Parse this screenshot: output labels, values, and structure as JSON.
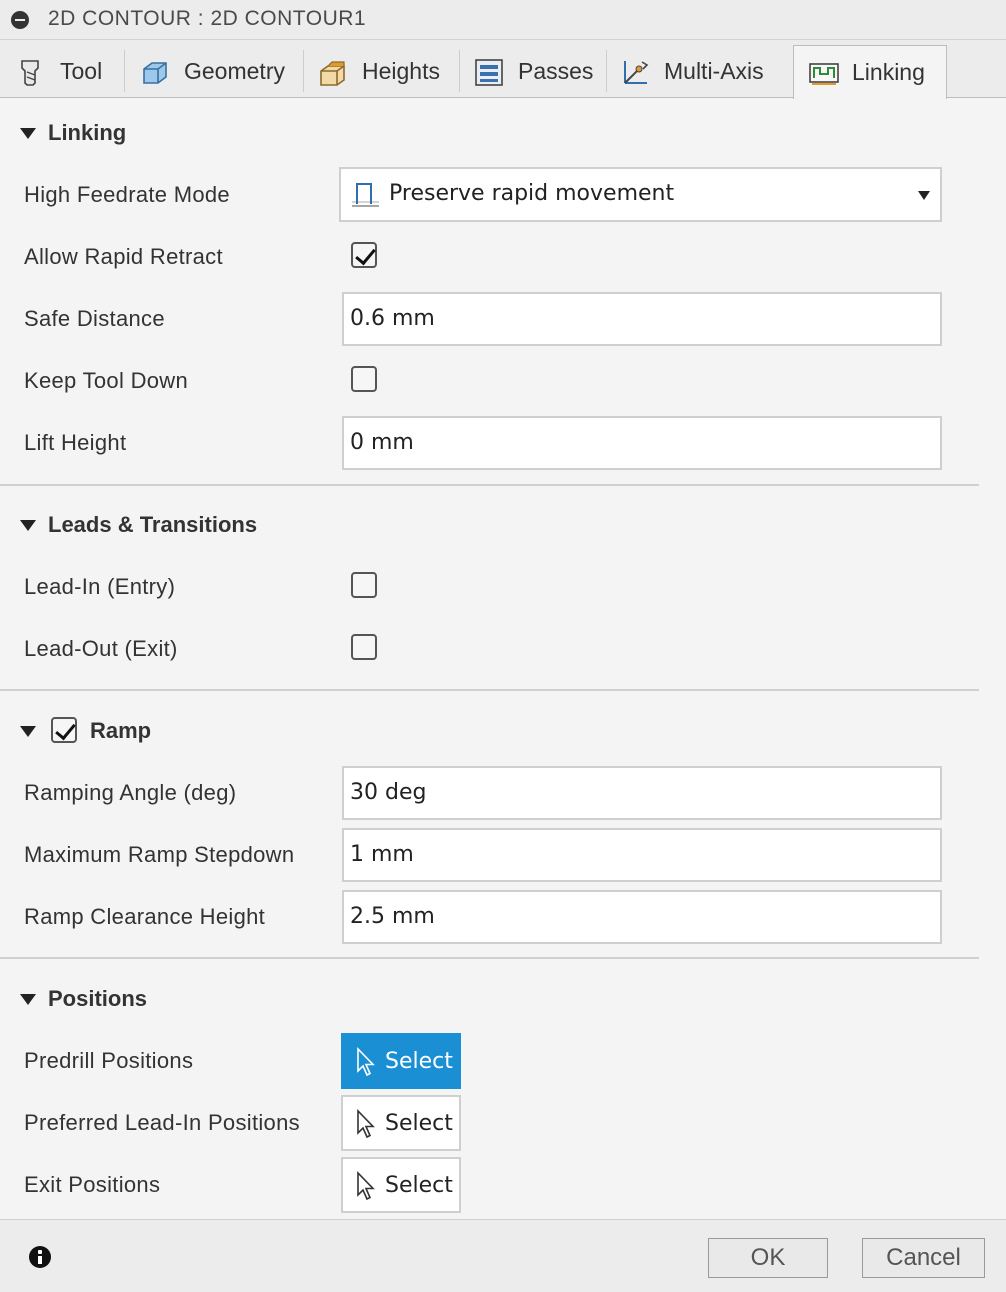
{
  "window": {
    "title": "2D CONTOUR : 2D CONTOUR1"
  },
  "tabs": [
    {
      "label": "Tool",
      "icon": "tool-icon"
    },
    {
      "label": "Geometry",
      "icon": "geometry-icon"
    },
    {
      "label": "Heights",
      "icon": "heights-icon"
    },
    {
      "label": "Passes",
      "icon": "passes-icon"
    },
    {
      "label": "Multi-Axis",
      "icon": "multi-axis-icon"
    },
    {
      "label": "Linking",
      "icon": "linking-icon",
      "active": true
    }
  ],
  "linking": {
    "title": "Linking",
    "high_feedrate_mode": {
      "label": "High Feedrate Mode",
      "value": "Preserve rapid movement"
    },
    "allow_rapid_retract": {
      "label": "Allow Rapid Retract",
      "checked": true
    },
    "safe_distance": {
      "label": "Safe Distance",
      "value": "0.6 mm"
    },
    "keep_tool_down": {
      "label": "Keep Tool Down",
      "checked": false
    },
    "lift_height": {
      "label": "Lift Height",
      "value": "0 mm"
    }
  },
  "leads": {
    "title": "Leads & Transitions",
    "lead_in": {
      "label": "Lead-In (Entry)",
      "checked": false
    },
    "lead_out": {
      "label": "Lead-Out (Exit)",
      "checked": false
    }
  },
  "ramp": {
    "title": "Ramp",
    "enabled": true,
    "ramping_angle": {
      "label": "Ramping Angle (deg)",
      "value": "30 deg"
    },
    "max_ramp_stepdown": {
      "label": "Maximum Ramp Stepdown",
      "value": "1 mm"
    },
    "ramp_clearance_height": {
      "label": "Ramp Clearance Height",
      "value": "2.5 mm"
    }
  },
  "positions": {
    "title": "Positions",
    "predrill": {
      "label": "Predrill Positions",
      "button": "Select"
    },
    "preferred_lead_in": {
      "label": "Preferred Lead-In Positions",
      "button": "Select"
    },
    "exit": {
      "label": "Exit Positions",
      "button": "Select"
    }
  },
  "footer": {
    "ok": "OK",
    "cancel": "Cancel"
  },
  "colors": {
    "accent": "#1a8fd4"
  }
}
